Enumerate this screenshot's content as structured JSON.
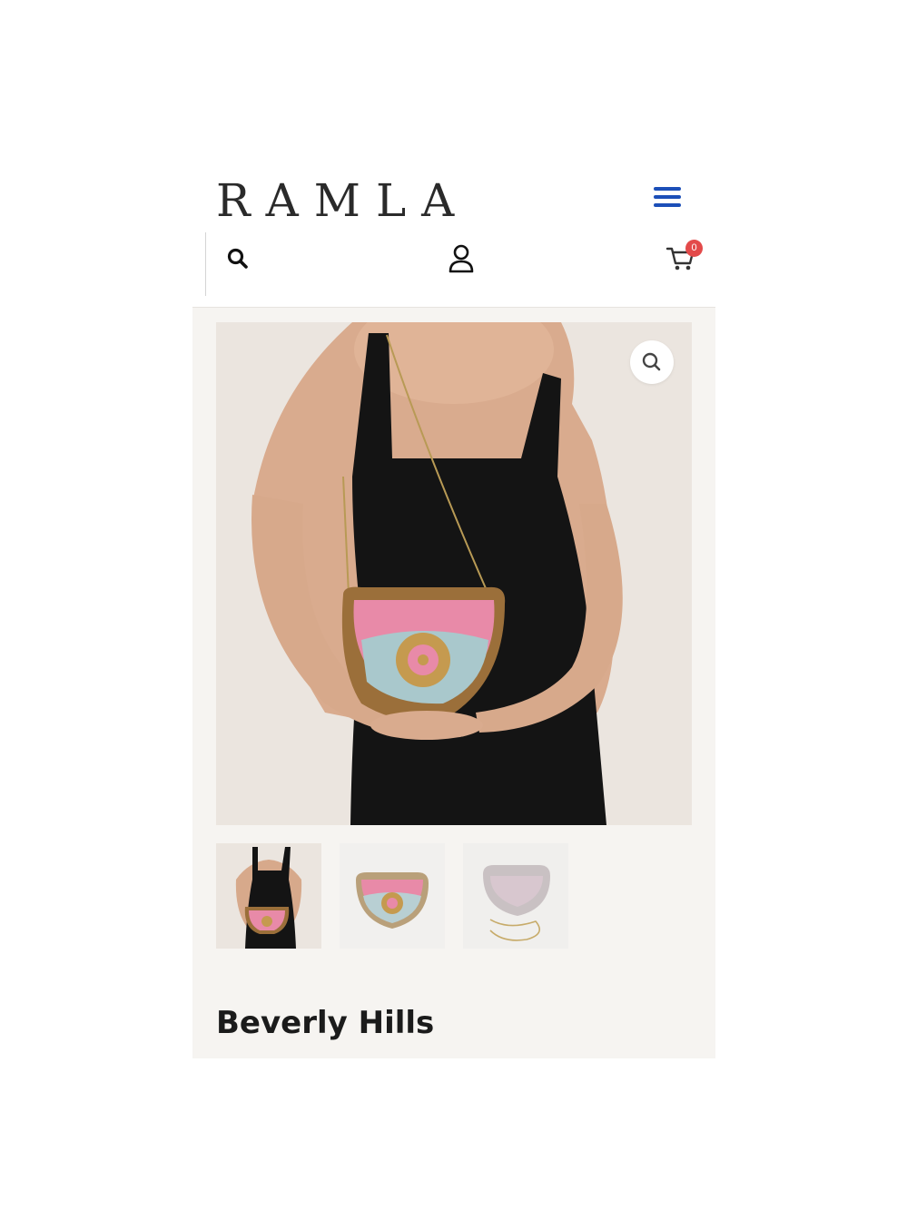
{
  "header": {
    "logo_text": "RAMLA",
    "menu_icon": "hamburger-menu-icon",
    "accent_color": "#1c4fb8"
  },
  "toolbar": {
    "search_icon": "search-icon",
    "account_icon": "user-icon",
    "cart_icon": "cart-icon",
    "cart_count": "0",
    "badge_color": "#e34a4a"
  },
  "product": {
    "title": "Beverly Hills",
    "zoom_icon": "magnifier-icon",
    "thumbnail_count": 3,
    "selected_thumbnail": 1
  }
}
